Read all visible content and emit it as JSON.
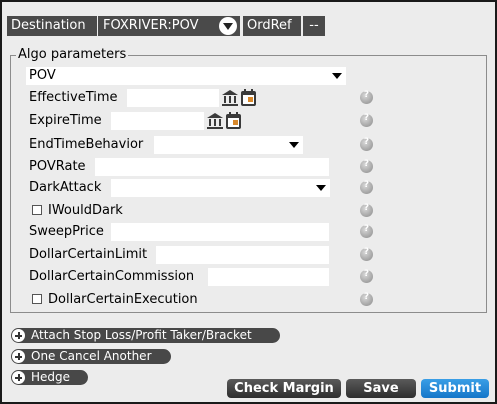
{
  "header": {
    "destination_label": "Destination",
    "destination_value": "FOXRIVER:POV",
    "ordref_label": "OrdRef",
    "ordref_value": "--"
  },
  "algo": {
    "legend": "Algo parameters",
    "strategy": "POV",
    "fields": {
      "effective_time": {
        "label": "EffectiveTime",
        "value": ""
      },
      "expire_time": {
        "label": "ExpireTime",
        "value": ""
      },
      "end_time_behavior": {
        "label": "EndTimeBehavior",
        "value": ""
      },
      "pov_rate": {
        "label": "POVRate",
        "value": ""
      },
      "dark_attack": {
        "label": "DarkAttack",
        "value": ""
      },
      "i_would_dark": {
        "label": "IWouldDark",
        "checked": false
      },
      "sweep_price": {
        "label": "SweepPrice",
        "value": ""
      },
      "dollar_certain_limit": {
        "label": "DollarCertainLimit",
        "value": ""
      },
      "dollar_certain_commission": {
        "label": "DollarCertainCommission",
        "value": ""
      },
      "dollar_certain_execution": {
        "label": "DollarCertainExecution",
        "checked": false
      }
    }
  },
  "attachments": {
    "stop_loss": "Attach Stop Loss/Profit Taker/Bracket",
    "one_cancel": "One Cancel Another",
    "hedge": "Hedge"
  },
  "actions": {
    "check_margin": "Check Margin",
    "save": "Save",
    "submit": "Submit"
  },
  "colors": {
    "label_bg": "#4a4a4a",
    "panel_bg": "#ececec",
    "submit_blue": "#1576c9"
  }
}
